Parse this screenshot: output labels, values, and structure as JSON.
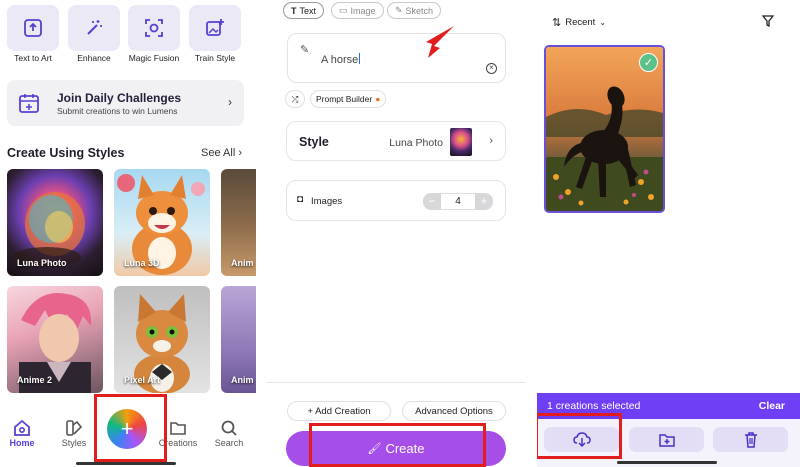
{
  "home": {
    "tools": [
      {
        "label": "Text to Art",
        "icon": "upload-box-icon"
      },
      {
        "label": "Enhance",
        "icon": "magic-wand-icon"
      },
      {
        "label": "Magic Fusion",
        "icon": "focus-scan-icon"
      },
      {
        "label": "Train Style",
        "icon": "image-plus-icon"
      }
    ],
    "challenge": {
      "title": "Join Daily Challenges",
      "subtitle": "Submit creations to win Lumens"
    },
    "styles_section": {
      "title": "Create Using Styles",
      "see_all": "See All"
    },
    "style_cards": [
      {
        "label": "Luna Photo"
      },
      {
        "label": "Luna 3D"
      },
      {
        "label": "Anim"
      },
      {
        "label": "Anime 2"
      },
      {
        "label": "Pixel Art"
      },
      {
        "label": "Anim"
      }
    ],
    "nav": {
      "home": "Home",
      "styles": "Styles",
      "creations": "Creations",
      "search": "Search"
    },
    "fab_icon": "plus-icon"
  },
  "create": {
    "modes": {
      "text": "Text",
      "image": "Image",
      "sketch": "Sketch"
    },
    "prompt": "A horse",
    "prompt_builder": "Prompt Builder",
    "style": {
      "label": "Style",
      "value": "Luna Photo"
    },
    "images": {
      "label": "Images",
      "value": "4"
    },
    "add_creation": "+ Add Creation",
    "advanced_options": "Advanced Options",
    "create_button": "Create"
  },
  "creations": {
    "sort": "Recent",
    "selection": {
      "count_text": "1 creations selected",
      "clear": "Clear"
    },
    "actions": [
      "download-icon",
      "folder-plus-icon",
      "trash-icon"
    ]
  },
  "colors": {
    "accent": "#a54ee8",
    "selection_bar": "#6f3ff5",
    "highlight_box": "#e21d1d"
  }
}
